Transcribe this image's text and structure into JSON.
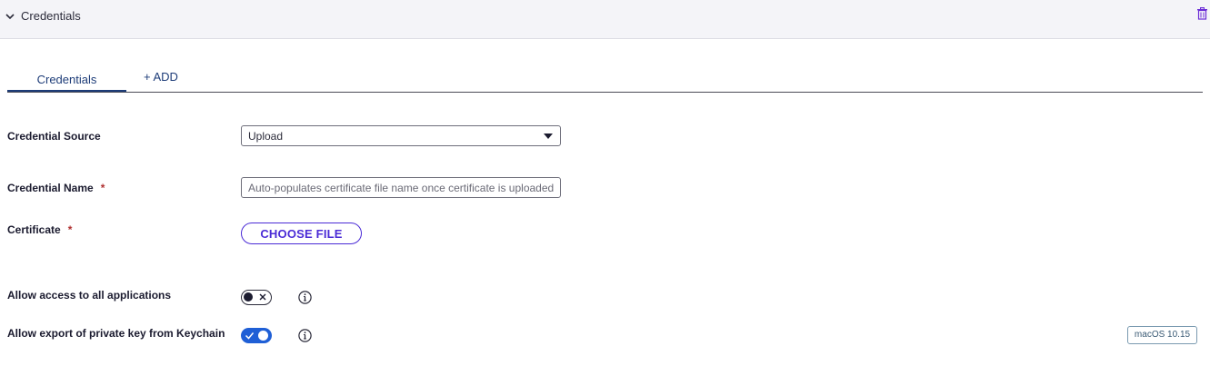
{
  "section": {
    "title": "Credentials"
  },
  "tabs": {
    "active_label": "Credentials",
    "add_label": "+ ADD"
  },
  "form": {
    "credential_source": {
      "label": "Credential Source",
      "value": "Upload"
    },
    "credential_name": {
      "label": "Credential Name",
      "required_mark": "*",
      "placeholder": "Auto-populates certificate file name once certificate is uploaded"
    },
    "certificate": {
      "label": "Certificate",
      "required_mark": "*",
      "button_label": "CHOOSE FILE"
    },
    "allow_access_all_apps": {
      "label": "Allow access to all applications",
      "enabled": false
    },
    "allow_export_private_key": {
      "label": "Allow export of private key from Keychain",
      "enabled": true,
      "badge": "macOS 10.15"
    }
  },
  "icons": {
    "collapse": "chevron-down-icon",
    "delete": "trash-icon",
    "select_caret": "caret-down-icon",
    "info": "info-icon"
  },
  "colors": {
    "accent": "#1d3c78",
    "button": "#4a2bd6",
    "toggle_on": "#1f5fd6",
    "trash": "#6a2bd6"
  }
}
